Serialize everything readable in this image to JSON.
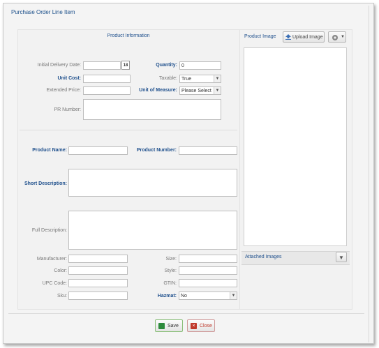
{
  "window": {
    "title": "Purchase Order Line Item"
  },
  "product_info": {
    "header": "Product Information",
    "initial_delivery_date": {
      "label": "Initial Delivery Date:",
      "value": "",
      "calendar_icon_text": "18"
    },
    "quantity": {
      "label": "Quantity:",
      "value": "0"
    },
    "unit_cost": {
      "label": "Unit Cost:",
      "value": ""
    },
    "taxable": {
      "label": "Taxable:",
      "value": "True"
    },
    "extended_price": {
      "label": "Extended Price:",
      "value": ""
    },
    "unit_of_measure": {
      "label": "Unit of Measure:",
      "value": "Please Select"
    },
    "pr_number": {
      "label": "PR Number:",
      "value": ""
    },
    "product_name": {
      "label": "Product Name:",
      "value": ""
    },
    "product_number": {
      "label": "Product Number:",
      "value": ""
    },
    "short_description": {
      "label": "Short Description:",
      "value": ""
    },
    "full_description": {
      "label": "Full Description:",
      "value": ""
    },
    "manufacturer": {
      "label": "Manufacturer:",
      "value": ""
    },
    "size": {
      "label": "Size:",
      "value": ""
    },
    "color": {
      "label": "Color:",
      "value": ""
    },
    "style": {
      "label": "Style:",
      "value": ""
    },
    "upc_code": {
      "label": "UPC Code:",
      "value": ""
    },
    "gtin": {
      "label": "GTIN:",
      "value": ""
    },
    "sku": {
      "label": "Sku:",
      "value": ""
    },
    "hazmat": {
      "label": "Hazmat:",
      "value": "No"
    }
  },
  "product_image": {
    "header": "Product Image",
    "upload_label": "Upload Image",
    "attached_images_label": "Attached Images"
  },
  "footer": {
    "save_label": "Save",
    "close_label": "Close"
  },
  "colors": {
    "accent": "#1e4f8c",
    "save_icon": "#2e8b3d",
    "close_icon": "#c0392b"
  },
  "icons": [
    "calendar-icon",
    "upload-icon",
    "gear-icon",
    "chevron-down-icon",
    "save-icon",
    "close-icon"
  ]
}
